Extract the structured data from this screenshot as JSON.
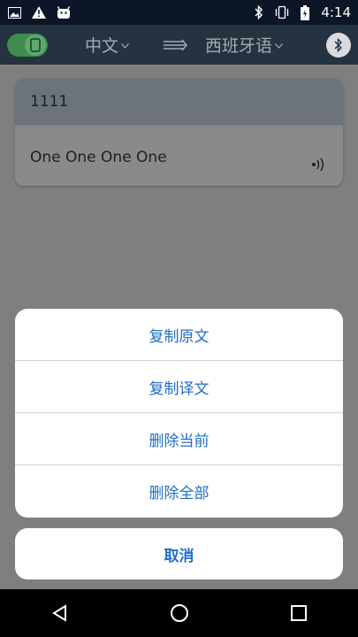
{
  "status_bar": {
    "time": "4:14",
    "icons": [
      "image-icon",
      "alert-icon",
      "android-icon",
      "bluetooth-icon",
      "vibrate-icon",
      "battery-icon"
    ]
  },
  "toolbar": {
    "source_language": "中文",
    "target_language": "西班牙语",
    "icons": [
      "phone-toggle-icon",
      "swap-arrows-icon",
      "bluetooth-icon"
    ]
  },
  "card": {
    "source_text": "1111",
    "translated_text": "One One One One",
    "speaker_icon": "speaker-icon"
  },
  "action_sheet": {
    "items": [
      "复制原文",
      "复制译文",
      "删除当前",
      "删除全部"
    ],
    "cancel_label": "取消"
  },
  "colors": {
    "accent": "#1e6fc8",
    "toggle_on": "#3e8c4e"
  }
}
